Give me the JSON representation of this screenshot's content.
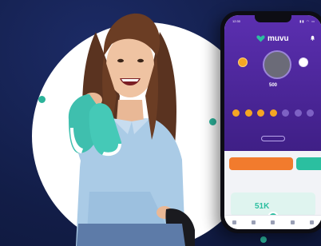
{
  "app": {
    "brand": "muvu",
    "colors": {
      "background": "#14204d",
      "accent": "#5b2fb0",
      "teal": "#2bb39a",
      "orange": "#f27b2d"
    }
  },
  "phone": {
    "status_time": "12:30",
    "status_icons": "▮▮ ◠ ▭",
    "logo_text": "muvu",
    "left_stat": {
      "caption": "",
      "value": ""
    },
    "right_stat": {
      "caption": "",
      "value": ""
    },
    "points": {
      "number": "500",
      "unit": ""
    },
    "week_title": "",
    "days": [
      {
        "label": "",
        "done": true
      },
      {
        "label": "",
        "done": true
      },
      {
        "label": "",
        "done": true
      },
      {
        "label": "",
        "done": true
      },
      {
        "label": "",
        "done": false
      },
      {
        "label": "",
        "done": false
      },
      {
        "label": "",
        "done": false
      }
    ],
    "see_more": "",
    "banner_orange": "",
    "banner_green": "",
    "section_title": "",
    "challenge_big": "51K",
    "tabs": [
      {
        "label": ""
      },
      {
        "label": ""
      },
      {
        "label": ""
      },
      {
        "label": ""
      },
      {
        "label": ""
      }
    ]
  }
}
